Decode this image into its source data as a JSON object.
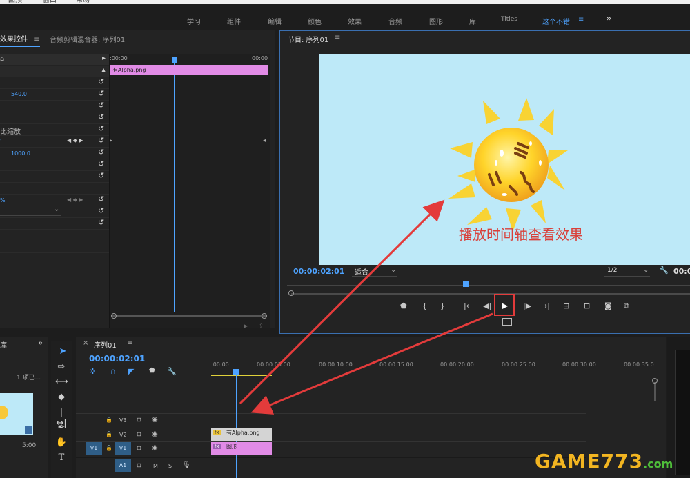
{
  "menu": {
    "m1": "回顶",
    "m2": "窗口",
    "m3": "帮助"
  },
  "workspaces": [
    "学习",
    "组件",
    "编辑",
    "颜色",
    "效果",
    "音频",
    "图形",
    "库",
    "Titles",
    "这个不错"
  ],
  "workspace_more": "≡",
  "workspace_overflow": "»",
  "effect_controls": {
    "tab_active": "效果控件",
    "tab_menu": "≡",
    "tab2": "音频剪辑混合器: 序列01",
    "header_left": "⌂",
    "time_start": ":00:00",
    "time_end": "00:00",
    "clip_name": "有Alpha.png",
    "value_position": "540.0",
    "label_uniform_scale": "比缩放",
    "value_anchor": "1000.0",
    "value_pct": "%",
    "select_placeholder": "⌄"
  },
  "program_monitor": {
    "title": "节目: 序列01",
    "title_menu": "≡",
    "timecode": "00:00:02:01",
    "fit_label": "适合",
    "resolution": "1/2",
    "right_time": "00:0",
    "annotation": "播放时间轴查看效果"
  },
  "project_panel": {
    "tab": "库",
    "item_count": "1 项已...",
    "duration": "5:00",
    "overflow": "»"
  },
  "timeline": {
    "tab_close": "×",
    "tab_label": "序列01",
    "tab_menu": "≡",
    "timecode": "00:00:02:01",
    "ruler": [
      ":00:00",
      "00:00:05:00",
      "00:00:10:00",
      "00:00:15:00",
      "00:00:20:00",
      "00:00:25:00",
      "00:00:30:00",
      "00:00:35:0"
    ],
    "tracks": [
      {
        "name": "V3",
        "label": "V3"
      },
      {
        "name": "V2",
        "label": "V2"
      },
      {
        "name": "V1",
        "label": "V1",
        "source": "V1"
      },
      {
        "name": "A1",
        "label": "A1",
        "m": "M",
        "s": "S"
      }
    ],
    "clip_v2": "有Alpha.png",
    "clip_v1": "图形",
    "fx": "fx"
  },
  "watermark": {
    "text": "GAME773",
    "suffix": ".com"
  },
  "colors": {
    "accent": "#4ea3ff",
    "clip_pink": "#e18be6",
    "clip_gray": "#d4d4d4",
    "monitor_bg": "#bde9f8",
    "arrow": "#e33b3b",
    "sun": "#f8c83a"
  }
}
